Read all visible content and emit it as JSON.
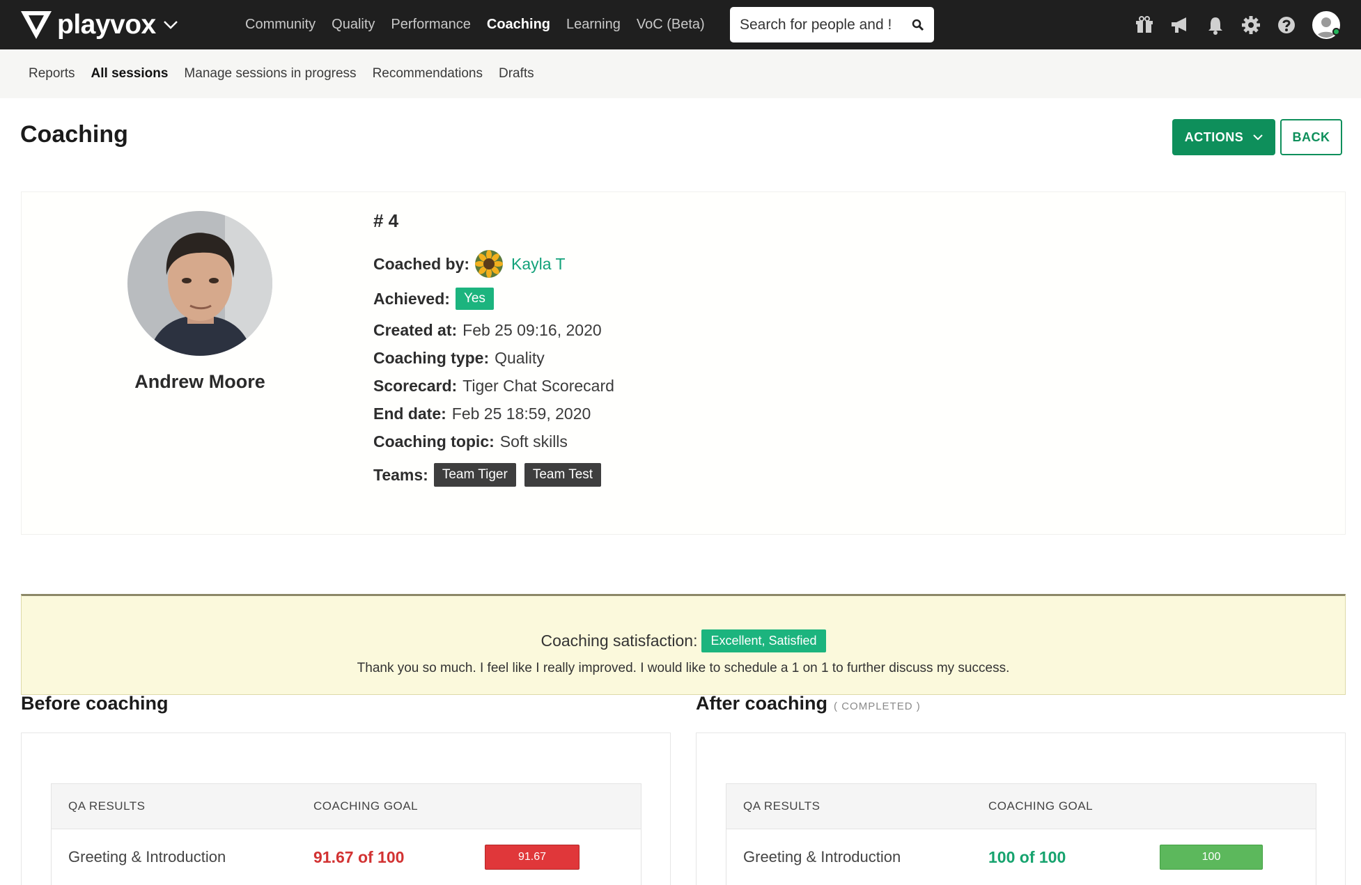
{
  "brand": {
    "name": "playvox"
  },
  "nav": {
    "links": [
      "Community",
      "Quality",
      "Performance",
      "Coaching",
      "Learning",
      "VoC (Beta)"
    ],
    "active": "Coaching",
    "search_placeholder": "Search for people and !"
  },
  "top_icons": [
    "gift-icon",
    "megaphone-icon",
    "bell-icon",
    "gear-icon",
    "help-icon",
    "user-avatar"
  ],
  "subnav": {
    "links": [
      "Reports",
      "All sessions",
      "Manage sessions in progress",
      "Recommendations",
      "Drafts"
    ],
    "active": "All sessions"
  },
  "page": {
    "title": "Coaching",
    "actions_label": "ACTIONS",
    "back_label": "BACK"
  },
  "profile": {
    "name": "Andrew Moore",
    "session_id": "# 4",
    "coached_by_label": "Coached by:",
    "coach_name": "Kayla T",
    "achieved_label": "Achieved:",
    "achieved_value": "Yes",
    "created_label": "Created at:",
    "created_value": "Feb 25 09:16, 2020",
    "type_label": "Coaching type:",
    "type_value": "Quality",
    "scorecard_label": "Scorecard:",
    "scorecard_value": "Tiger Chat Scorecard",
    "end_label": "End date:",
    "end_value": "Feb 25 18:59, 2020",
    "topic_label": "Coaching topic:",
    "topic_value": "Soft skills",
    "teams_label": "Teams:",
    "teams": [
      "Team Tiger",
      "Team Test"
    ]
  },
  "satisfaction": {
    "label": "Coaching satisfaction:",
    "badge": "Excellent, Satisfied",
    "comment": "Thank you so much. I feel like I really improved. I would like to schedule a 1 on 1 to further discuss my success."
  },
  "before": {
    "title": "Before coaching",
    "col_qa": "QA RESULTS",
    "col_goal": "COACHING GOAL",
    "rows": [
      {
        "category": "Greeting & Introduction",
        "score": "91.67 of 100",
        "bar_label": "91.67",
        "color": "#e0373a"
      }
    ]
  },
  "after": {
    "title": "After coaching",
    "status": "( COMPLETED )",
    "col_qa": "QA RESULTS",
    "col_goal": "COACHING GOAL",
    "rows": [
      {
        "category": "Greeting & Introduction",
        "score": "100 of 100",
        "bar_label": "100",
        "color": "#5cb85c"
      }
    ]
  },
  "colors": {
    "accent": "#0e8f5b",
    "link": "#13a27a",
    "score_low": "#d23232",
    "score_good": "#16a36e"
  }
}
